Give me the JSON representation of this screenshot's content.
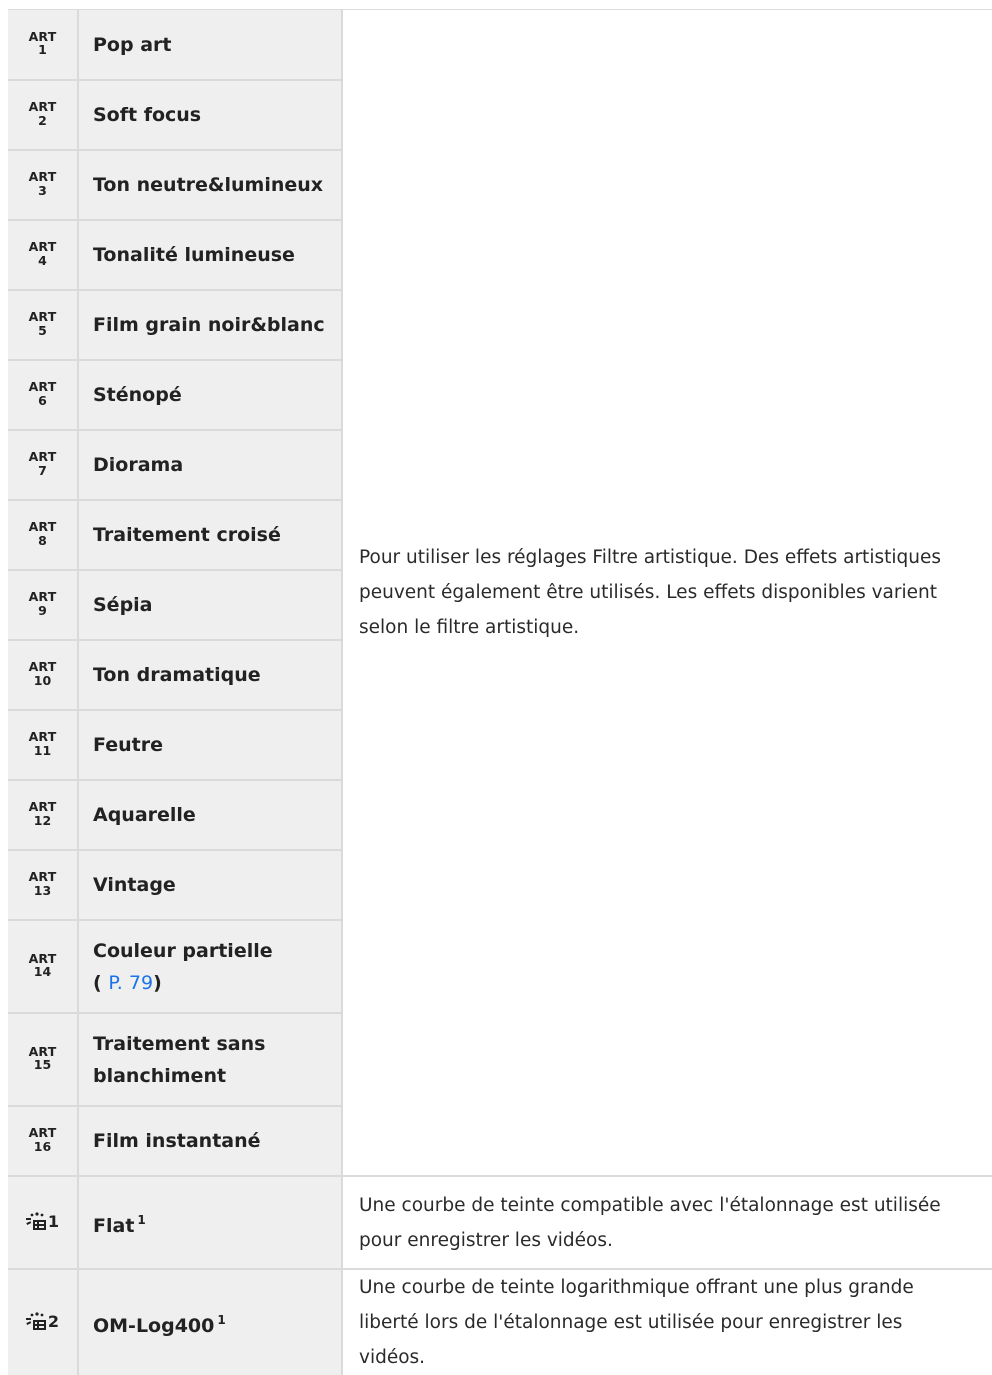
{
  "art_label": "ART",
  "art_rows": [
    {
      "num": "1",
      "name": "Pop art"
    },
    {
      "num": "2",
      "name": "Soft focus"
    },
    {
      "num": "3",
      "name": "Ton neutre&lumineux"
    },
    {
      "num": "4",
      "name": "Tonalité lumineuse"
    },
    {
      "num": "5",
      "name": "Film grain noir&blanc"
    },
    {
      "num": "6",
      "name": "Sténopé"
    },
    {
      "num": "7",
      "name": "Diorama"
    },
    {
      "num": "8",
      "name": "Traitement croisé"
    },
    {
      "num": "9",
      "name": "Sépia"
    },
    {
      "num": "10",
      "name": "Ton dramatique"
    },
    {
      "num": "11",
      "name": "Feutre"
    },
    {
      "num": "12",
      "name": "Aquarelle"
    },
    {
      "num": "13",
      "name": "Vintage"
    },
    {
      "num": "14",
      "name": "Couleur partielle",
      "link_prefix": "(",
      "link_icon": "page-reference-icon",
      "link_text": "P. 79",
      "link_suffix": ")"
    },
    {
      "num": "15",
      "name": "Traitement sans blanchiment"
    },
    {
      "num": "16",
      "name": "Film instantané"
    }
  ],
  "art_description": "Pour utiliser les réglages Filtre artistique. Des effets artistiques peuvent également être utilisés. Les effets disponibles varient selon le filtre artistique.",
  "video_rows": [
    {
      "icon": "picture-mode-video-icon",
      "num": "1",
      "name": "Flat",
      "footnote": "1",
      "description": "Une courbe de teinte compatible avec l'étalonnage est utilisée pour enregistrer les vidéos."
    },
    {
      "icon": "picture-mode-video-icon",
      "num": "2",
      "name": "OM-Log400",
      "footnote": "1",
      "description": "Une courbe de teinte logarithmique offrant une plus grande liberté lors de l'étalonnage est utilisée pour enregistrer les vidéos."
    }
  ],
  "colors": {
    "link": "#1a73e8",
    "cell_bg": "#efefef",
    "border": "#dadada"
  }
}
